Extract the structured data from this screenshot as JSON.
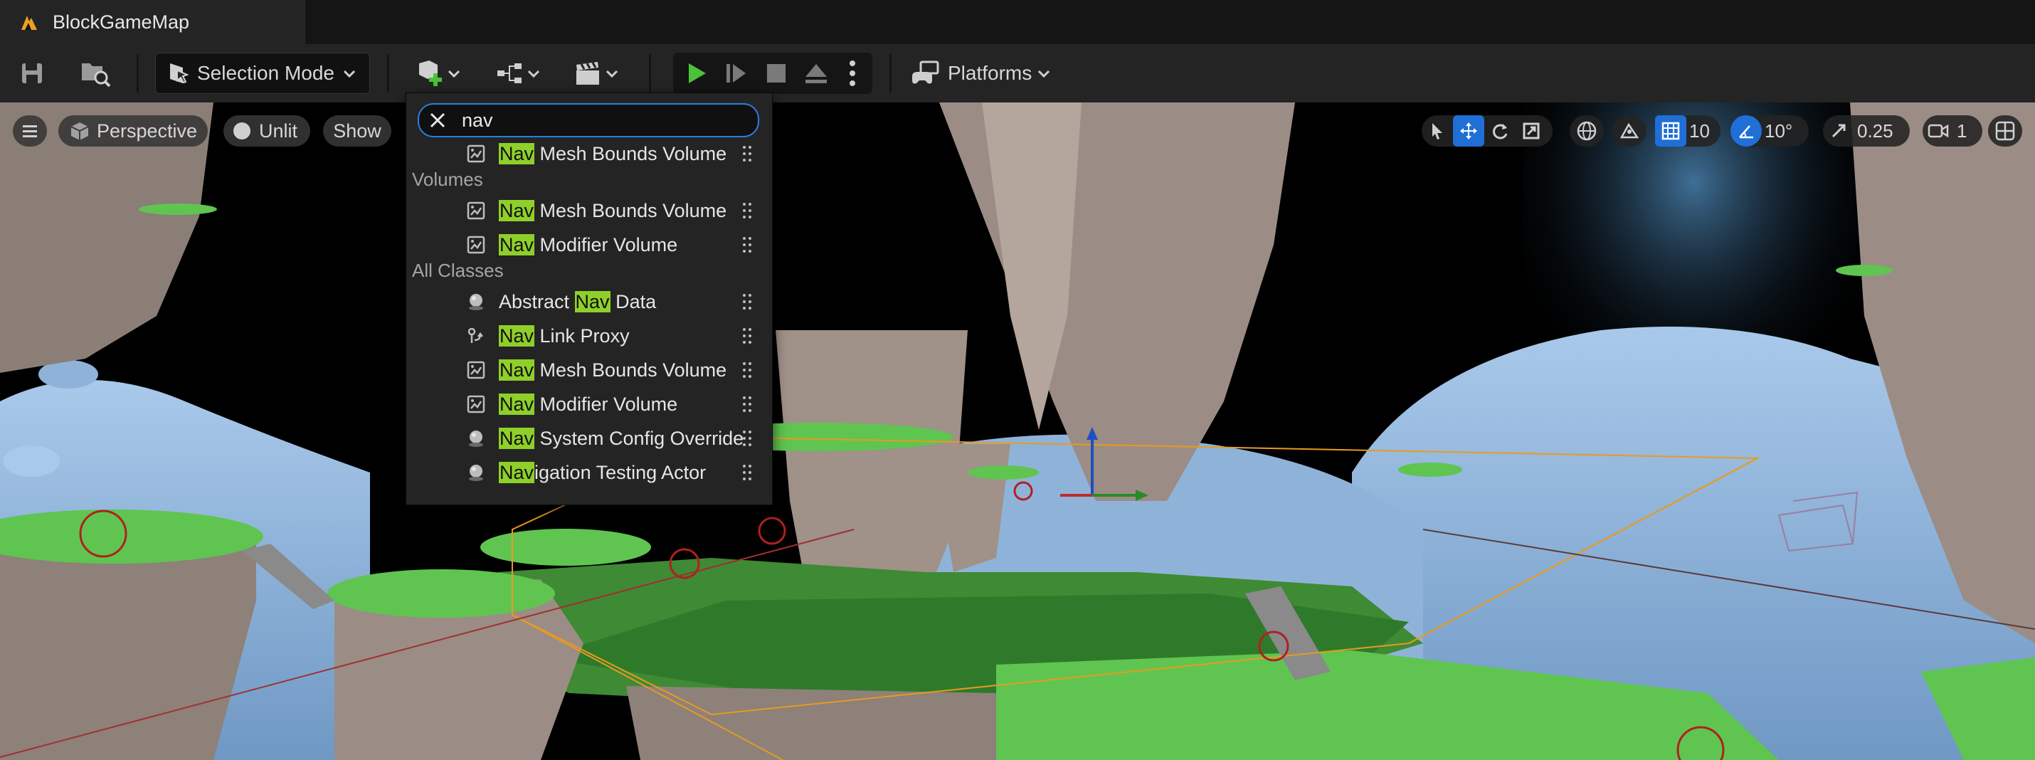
{
  "window": {
    "tab_title": "BlockGameMap"
  },
  "toolbar": {
    "selection_mode_label": "Selection Mode",
    "platforms_label": "Platforms"
  },
  "viewport": {
    "perspective_label": "Perspective",
    "unlit_label": "Unlit",
    "show_label": "Show",
    "grid_snap_value": "10",
    "rotation_snap_value": "10°",
    "scale_snap_value": "0.25",
    "camera_speed_value": "1"
  },
  "place_actors": {
    "search_value": "nav",
    "search_query": "Nav",
    "recent_items": [
      {
        "label": "Nav Mesh Bounds Volume",
        "match": "Nav",
        "rest": " Mesh Bounds Volume",
        "icon": "volume-icon"
      }
    ],
    "sections": [
      {
        "title": "Volumes",
        "items": [
          {
            "label": "Nav Mesh Bounds Volume",
            "match": "Nav",
            "rest": " Mesh Bounds Volume",
            "icon": "volume-icon"
          },
          {
            "label": "Nav Modifier Volume",
            "match": "Nav",
            "rest": " Modifier Volume",
            "icon": "volume-icon"
          }
        ]
      },
      {
        "title": "All Classes",
        "items": [
          {
            "pre": "Abstract ",
            "match": "Nav",
            "rest": " Data",
            "icon": "actor-sphere-icon"
          },
          {
            "match": "Nav",
            "rest": " Link Proxy",
            "icon": "nav-link-icon"
          },
          {
            "match": "Nav",
            "rest": " Mesh Bounds Volume",
            "icon": "volume-icon"
          },
          {
            "match": "Nav",
            "rest": " Modifier Volume",
            "icon": "volume-icon"
          },
          {
            "match": "Nav",
            "rest": " System Config Override",
            "icon": "actor-sphere-icon"
          },
          {
            "match": "Nav",
            "rest": "igation Testing Actor",
            "icon": "actor-sphere-icon"
          }
        ]
      }
    ]
  },
  "colors": {
    "accent_blue": "#2a7fe0",
    "match_highlight": "#8fcf2a",
    "play_green": "#4cc23a",
    "panel_bg": "#242424"
  }
}
